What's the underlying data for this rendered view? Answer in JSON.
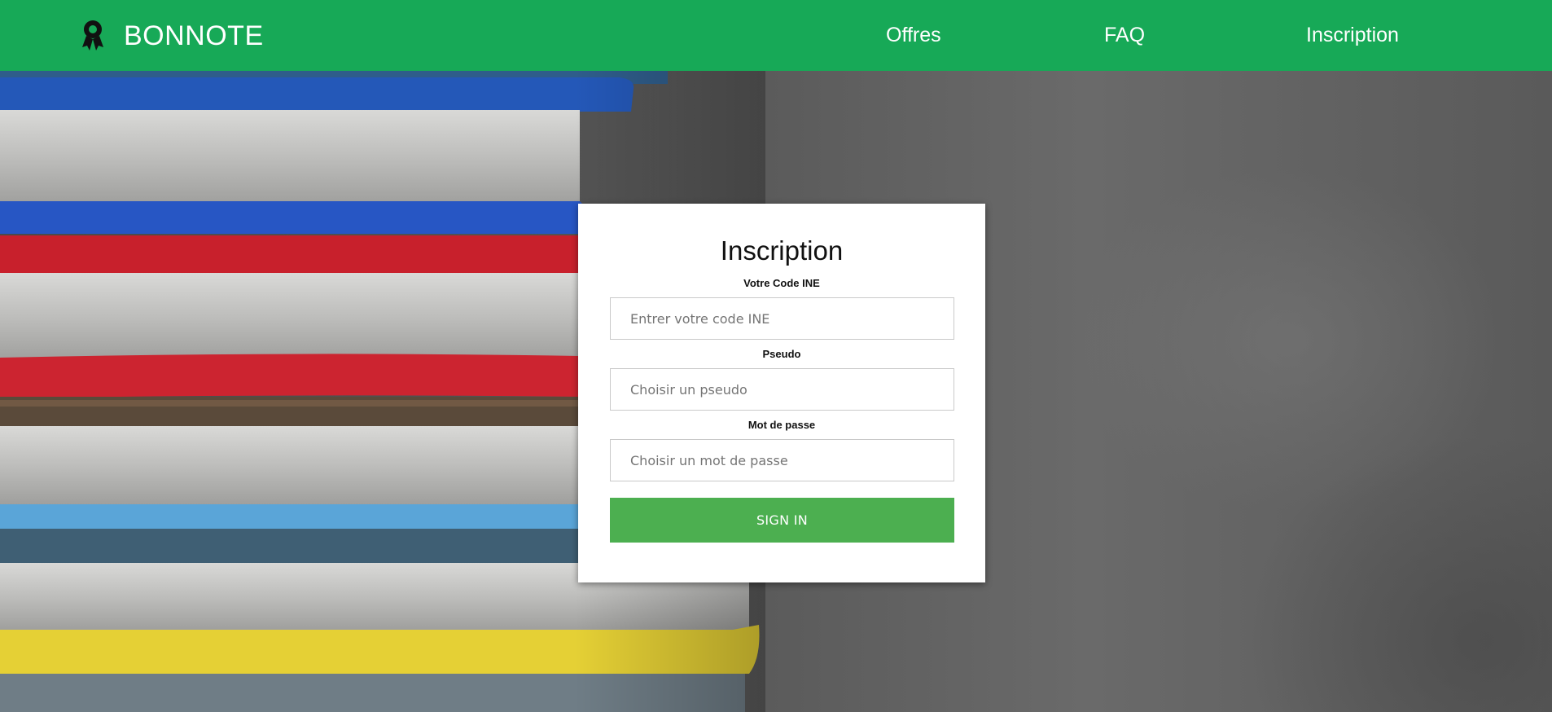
{
  "brand": {
    "name": "BONNOTE",
    "icon": "award-ribbon-icon"
  },
  "nav": {
    "offres": "Offres",
    "faq": "FAQ",
    "inscription": "Inscription"
  },
  "colors": {
    "header": "#17a957",
    "button": "#4caf50"
  },
  "form": {
    "title": "Inscription",
    "ine_label": "Votre Code INE",
    "ine_placeholder": "Entrer votre code INE",
    "pseudo_label": "Pseudo",
    "pseudo_placeholder": "Choisir un pseudo",
    "password_label": "Mot de passe",
    "password_placeholder": "Choisir un mot de passe",
    "submit_label": "SIGN IN"
  }
}
